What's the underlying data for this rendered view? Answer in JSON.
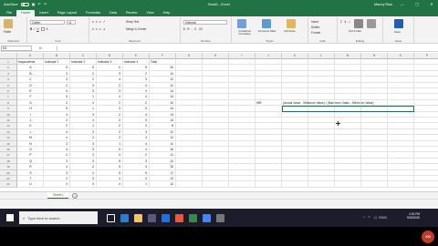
{
  "titlebar": {
    "autosave": "AutoSave",
    "autosave_state": "Off",
    "title": "Book1 - Excel",
    "user": "Manny Rios",
    "minimize": "—",
    "restore": "▢",
    "close": "✕"
  },
  "tabs": [
    "File",
    "Home",
    "Insert",
    "Page Layout",
    "Formulas",
    "Data",
    "Review",
    "View",
    "Help"
  ],
  "active_tab": "Home",
  "ribbon": {
    "groups": [
      "Clipboard",
      "Font",
      "Alignment",
      "Number",
      "Styles",
      "Cells",
      "Editing",
      "Ideas"
    ],
    "font_name": "Calibri",
    "font_size": "11",
    "wrap_text": "Wrap Text",
    "merge_center": "Merge & Center",
    "number_format": "General",
    "conditional_formatting": "Conditional Formatting",
    "format_as_table": "Format as Table",
    "cell_styles": "Cell Styles",
    "insert": "Insert",
    "delete": "Delete",
    "format": "Format",
    "sort_filter": "Sort & Filter",
    "find_select": "Find & Select",
    "ideas": "Ideas",
    "paste": "Paste"
  },
  "formula_bar": {
    "name_box": "K5",
    "fx": "fx",
    "value": ""
  },
  "columns": [
    "A",
    "B",
    "C",
    "D",
    "E",
    "F",
    "G",
    "H",
    "I",
    "J",
    "K",
    "L",
    "M",
    "N",
    "O",
    "P"
  ],
  "headers": [
    "respondents",
    "Indicator 1",
    "Indicator 2",
    "Indicator 3",
    "Indicator 4",
    "Total"
  ],
  "rows": [
    [
      "A",
      5,
      5,
      5,
      5,
      20
    ],
    [
      "B",
      3,
      2,
      3,
      2,
      10
    ],
    [
      "C",
      3,
      2,
      4,
      3,
      12
    ],
    [
      "D",
      2,
      3,
      3,
      4,
      12
    ],
    [
      "E",
      4,
      3,
      3,
      4,
      14
    ],
    [
      "F",
      5,
      1,
      4,
      4,
      14
    ],
    [
      "G",
      2,
      4,
      2,
      2,
      10
    ],
    [
      "H",
      5,
      1,
      3,
      5,
      14
    ],
    [
      "I",
      4,
      3,
      2,
      4,
      13
    ],
    [
      "J",
      2,
      4,
      2,
      5,
      13
    ],
    [
      "K",
      2,
      1,
      2,
      3,
      8
    ],
    [
      "L",
      4,
      3,
      2,
      3,
      12
    ],
    [
      "M",
      4,
      3,
      2,
      3,
      12
    ],
    [
      "N",
      3,
      3,
      1,
      4,
      11
    ],
    [
      "O",
      4,
      3,
      5,
      4,
      16
    ],
    [
      "P",
      2,
      3,
      4,
      2,
      11
    ],
    [
      "Q",
      3,
      3,
      5,
      3,
      14
    ],
    [
      "R",
      4,
      2,
      5,
      4,
      15
    ],
    [
      "S",
      3,
      4,
      5,
      5,
      17
    ],
    [
      "T",
      2,
      3,
      4,
      3,
      12
    ],
    [
      "U",
      4,
      3,
      4,
      1,
      12
    ]
  ],
  "formula_label": "HIB",
  "formula_text": "(Actual Value - Minimum Value) / (Maximum Value - Minimum Value)",
  "sheet": {
    "tab": "Sheet1",
    "add": "+"
  },
  "taskbar": {
    "search_placeholder": "Type here to search",
    "lang": "ENG",
    "region": "INTL",
    "time": "4:33 PM",
    "date": "9/15/2020"
  },
  "logo": "XG"
}
